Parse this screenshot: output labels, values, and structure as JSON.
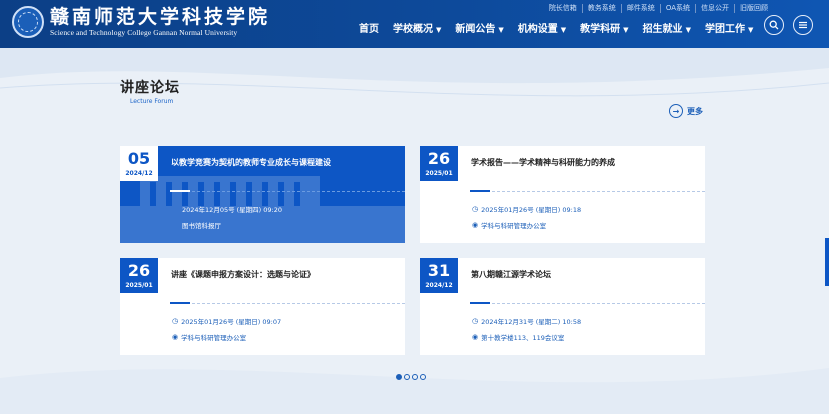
{
  "header": {
    "school_cn": "赣南师范大学科技学院",
    "school_en": "Science and Technology College Gannan Normal University",
    "top_links": [
      "院长信箱",
      "教务系统",
      "邮件系统",
      "OA系统",
      "信息公开",
      "旧版回顾"
    ],
    "nav": [
      {
        "label": "首页",
        "dropdown": false
      },
      {
        "label": "学校概况",
        "dropdown": true
      },
      {
        "label": "新闻公告",
        "dropdown": true
      },
      {
        "label": "机构设置",
        "dropdown": true
      },
      {
        "label": "教学科研",
        "dropdown": true
      },
      {
        "label": "招生就业",
        "dropdown": true
      },
      {
        "label": "学团工作",
        "dropdown": true
      }
    ],
    "search_icon": "search-icon",
    "menu_icon": "menu-icon"
  },
  "section": {
    "title_cn": "讲座论坛",
    "title_en": "Lecture Forum",
    "more_label": "更多"
  },
  "cards": [
    {
      "day": "05",
      "ym": "2024/12",
      "title": "以教学竞赛为契机的教师专业成长与课程建设",
      "time": "2024年12月05号 (星期四) 09:20",
      "place": "图书馆科报厅",
      "active": true
    },
    {
      "day": "26",
      "ym": "2025/01",
      "title": "学术报告——学术精神与科研能力的养成",
      "time": "2025年01月26号 (星期日) 09:18",
      "place": "学科与科研管理办公室",
      "active": false
    },
    {
      "day": "26",
      "ym": "2025/01",
      "title": "讲座《课题申报方案设计：选题与论证》",
      "time": "2025年01月26号 (星期日) 09:07",
      "place": "学科与科研管理办公室",
      "active": false
    },
    {
      "day": "31",
      "ym": "2024/12",
      "title": "第八期赣江源学术论坛",
      "time": "2024年12月31号 (星期二) 10:58",
      "place": "第十教学楼113、119会议室",
      "active": false
    }
  ],
  "pager": {
    "count": 4,
    "current": 0
  },
  "colors": {
    "primary": "#0d56c5",
    "header": "#0c3f86",
    "background": "#eaf0f7"
  }
}
